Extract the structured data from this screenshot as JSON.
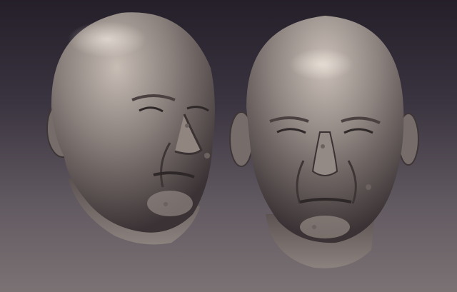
{
  "image": {
    "subject": "two-sculpted-heads",
    "colors": {
      "background_top": "#241f29",
      "background_bottom": "#7a7273",
      "clay_base": "#8a807c",
      "clay_highlight": "#c7bdb5",
      "clay_shadow": "#3a3234"
    }
  }
}
